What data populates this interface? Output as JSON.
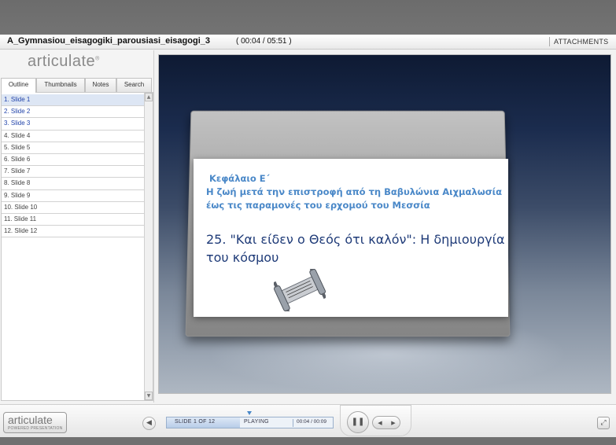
{
  "window": {
    "title": "A_Gymnasiou_eisagogiki_parousiasi_eisagogi_3",
    "time": "( 00:04 / 05:51 )",
    "attachments_label": "ATTACHMENTS"
  },
  "sidebar": {
    "logo": "articulate",
    "tabs": [
      {
        "label": "Outline",
        "active": true
      },
      {
        "label": "Thumbnails",
        "active": false
      },
      {
        "label": "Notes",
        "active": false
      },
      {
        "label": "Search",
        "active": false
      }
    ],
    "slides": [
      {
        "label": "1. Slide 1"
      },
      {
        "label": "2. Slide 2"
      },
      {
        "label": "3. Slide 3"
      },
      {
        "label": "4. Slide 4"
      },
      {
        "label": "5. Slide 5"
      },
      {
        "label": "6. Slide 6"
      },
      {
        "label": "7. Slide 7"
      },
      {
        "label": "8. Slide 8"
      },
      {
        "label": "9. Slide 9"
      },
      {
        "label": "10. Slide 10"
      },
      {
        "label": "11. Slide 11"
      },
      {
        "label": "12. Slide 12"
      }
    ]
  },
  "slide": {
    "chapter": "Κεφάλαιο Ε΄",
    "subtitle": "Η ζωή μετά την επιστροφή από τη Βαβυλώνια Αιχμαλωσία έως τις παραμονές του ερχομού του Μεσσία",
    "lesson_title": "25. \"Και είδεν ο Θεός ότι καλόν\": Η δημιουργία του κόσμου"
  },
  "controls": {
    "logo": "articulate",
    "logo_sub": "POWERED PRESENTATION",
    "slide_counter": "SLIDE 1 OF 12",
    "status": "PLAYING",
    "slide_time": "00:04 / 00:09",
    "progress_fraction": 0.44
  }
}
